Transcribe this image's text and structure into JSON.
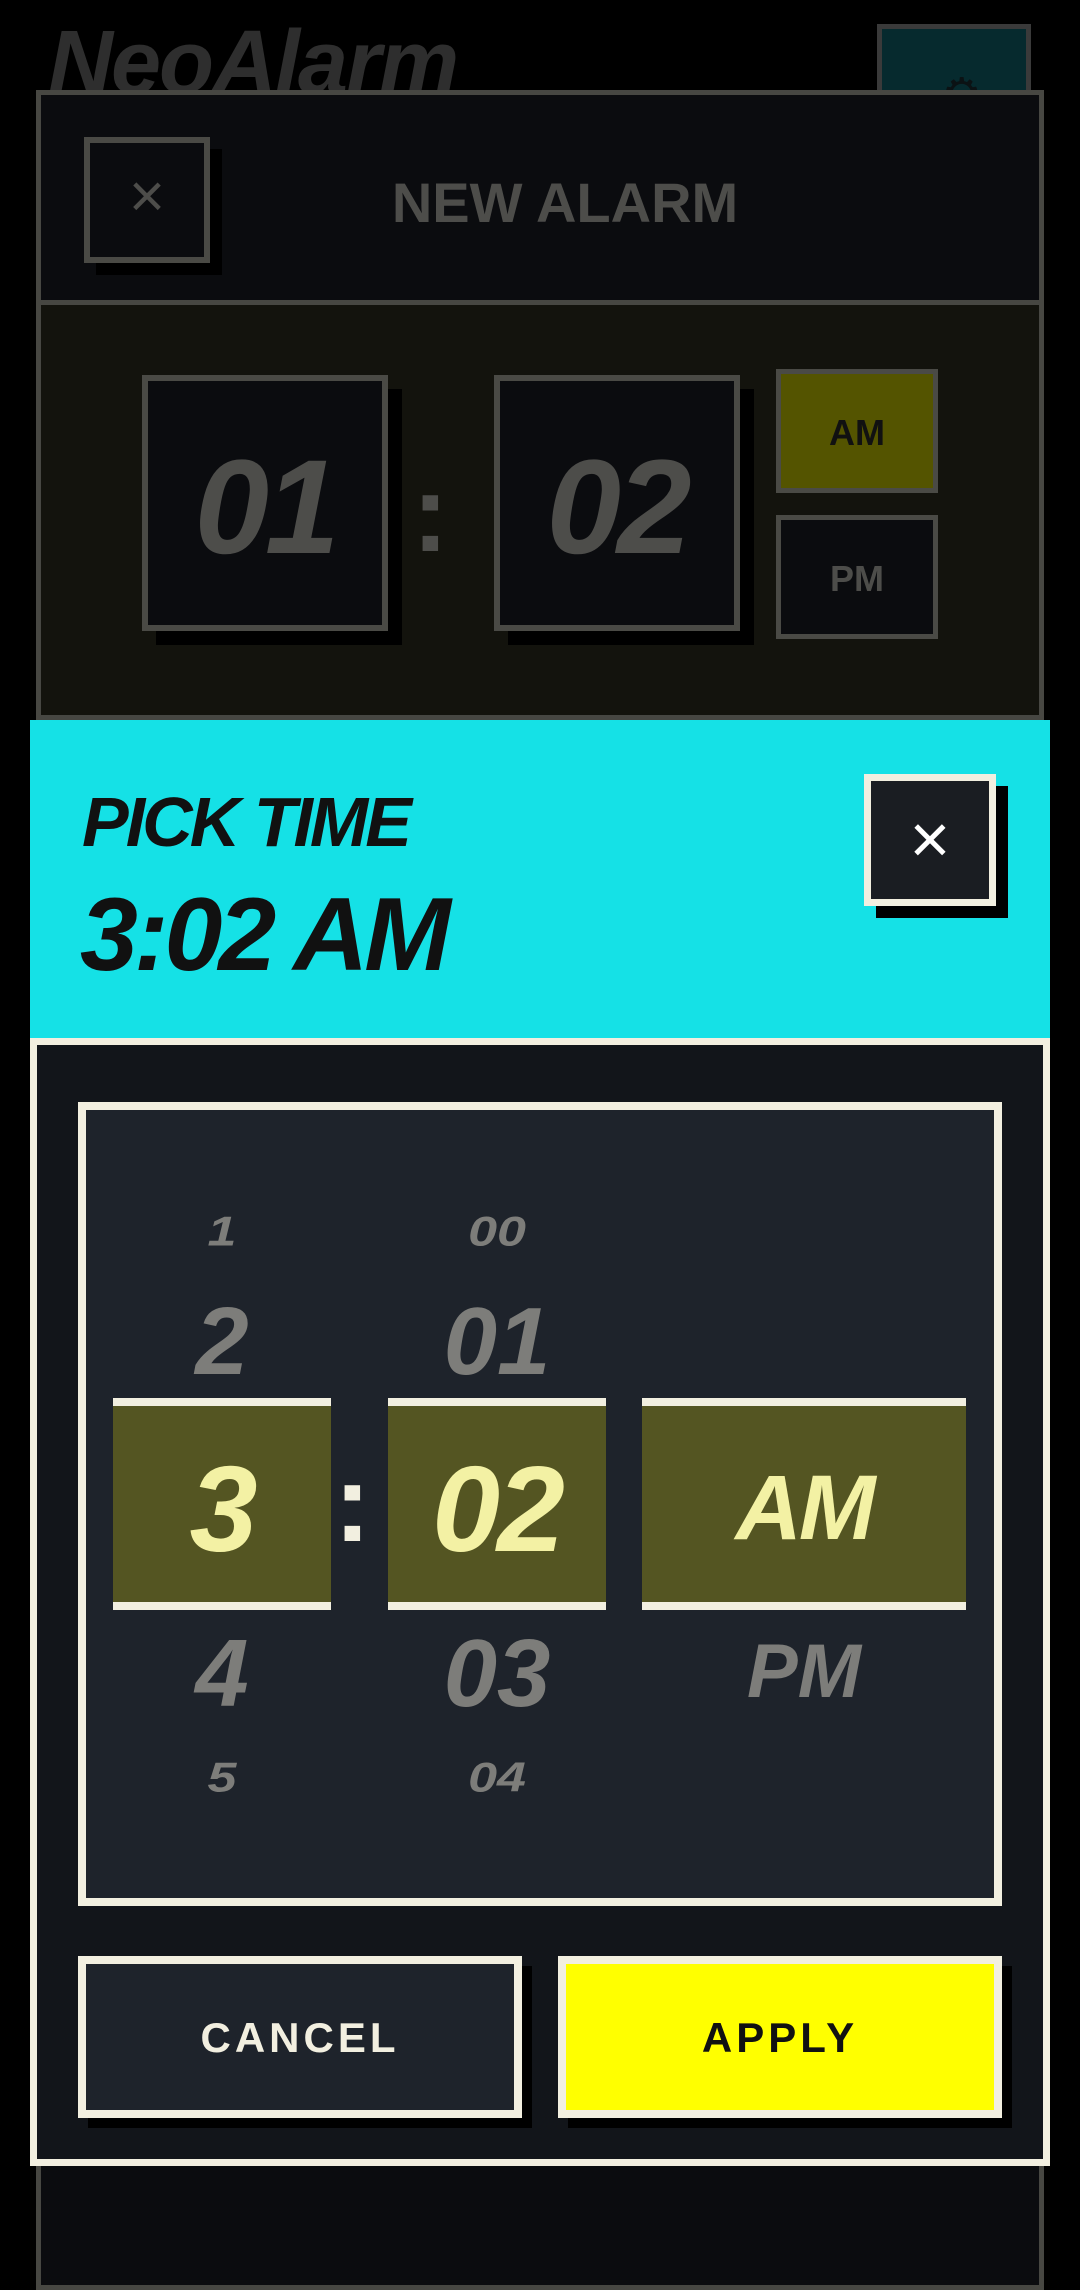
{
  "app": {
    "title": "NeoAlarm",
    "settings_icon": "gear-icon"
  },
  "alarm_dialog": {
    "title": "NEW ALARM",
    "close_glyph": "×",
    "hour": "01",
    "separator": ":",
    "minute": "02",
    "am_label": "AM",
    "pm_label": "PM",
    "selected_period": "AM"
  },
  "picker": {
    "title": "PICK TIME",
    "time_display": "3:02 AM",
    "close_glyph": "×",
    "hours": {
      "far_above": "1",
      "above": "2",
      "selected": "3",
      "below": "4",
      "far_below": "5"
    },
    "separator": ":",
    "minutes": {
      "far_above": "00",
      "above": "01",
      "selected": "02",
      "below": "03",
      "far_below": "04"
    },
    "periods": {
      "selected": "AM",
      "below": "PM"
    },
    "cancel_label": "CANCEL",
    "apply_label": "APPLY"
  },
  "colors": {
    "accent_cyan": "#15e1e6",
    "apply_yellow": "#ffff00",
    "selection_olive": "#545522",
    "selection_text": "#f3f1a4",
    "frame_white": "#f2efe0"
  }
}
